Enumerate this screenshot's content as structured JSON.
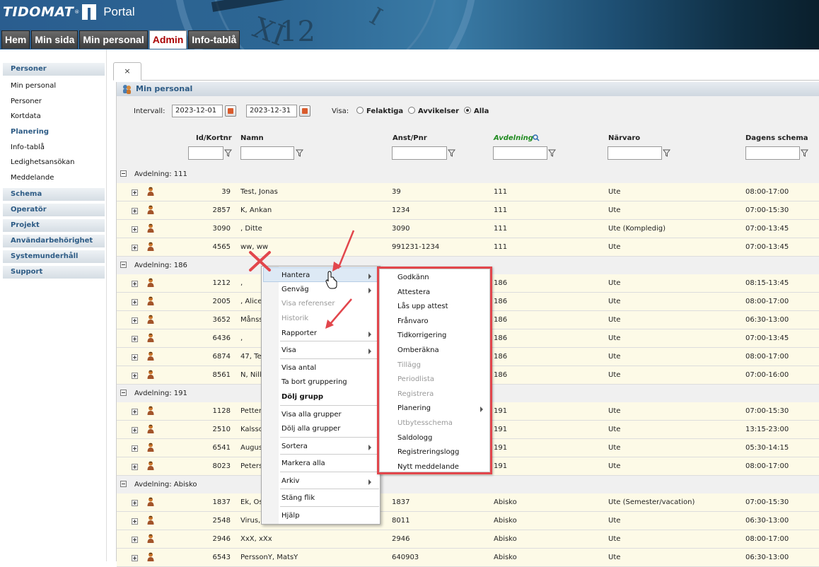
{
  "header": {
    "brand": "TIDOMAT",
    "trademark": "®",
    "portal": "Portal",
    "nav": [
      "Hem",
      "Min sida",
      "Min personal",
      "Admin",
      "Info-tablå"
    ],
    "active_nav": "Admin"
  },
  "sidebar": {
    "personer_heading": "Personer",
    "personer_items": [
      "Min personal",
      "Personer",
      "Kortdata"
    ],
    "planering_heading": "Planering",
    "planering_items": [
      "Info-tablå",
      "Ledighetsansökan",
      "Meddelande"
    ],
    "sections": [
      "Schema",
      "Operatör",
      "Projekt",
      "Användarbehörighet",
      "Systemunderhåll",
      "Support"
    ]
  },
  "tab": {
    "close": "×"
  },
  "panel": {
    "title": "Min personal",
    "intervall_label": "Intervall:",
    "date_from": "2023-12-01",
    "date_to": "2023-12-31",
    "visa_label": "Visa:",
    "radio_options": [
      "Felaktiga",
      "Avvikelser",
      "Alla"
    ],
    "radio_selected": "Alla"
  },
  "columns": {
    "id": "Id/Kortnr",
    "name": "Namn",
    "anst": "Anst/Pnr",
    "avd": "Avdelning",
    "narvaro": "Närvaro",
    "schema": "Dagens schema",
    "avd_color": "#1f8a1f"
  },
  "groups": [
    {
      "label": "Avdelning: 111",
      "rows": [
        {
          "id": "39",
          "name": "Test, Jonas",
          "anst": "39",
          "avd": "111",
          "narvaro": "Ute",
          "schema": "08:00-17:00"
        },
        {
          "id": "2857",
          "name": "K, Ankan",
          "anst": "1234",
          "avd": "111",
          "narvaro": "Ute",
          "schema": "07:00-15:30"
        },
        {
          "id": "3090",
          "name": ", Ditte",
          "anst": "3090",
          "avd": "111",
          "narvaro": "Ute (Kompledig)",
          "schema": "07:00-13:45"
        },
        {
          "id": "4565",
          "name": "ww, ww",
          "anst": "991231-1234",
          "avd": "111",
          "narvaro": "Ute",
          "schema": "07:00-13:45"
        }
      ]
    },
    {
      "label": "Avdelning: 186",
      "rows": [
        {
          "id": "1212",
          "name": ",",
          "anst": "",
          "avd": "186",
          "narvaro": "Ute",
          "schema": "08:15-13:45"
        },
        {
          "id": "2005",
          "name": ", Alice",
          "anst": "",
          "avd": "186",
          "narvaro": "Ute",
          "schema": "08:00-17:00"
        },
        {
          "id": "3652",
          "name": "Månss",
          "anst": "",
          "avd": "186",
          "narvaro": "Ute",
          "schema": "06:30-13:00"
        },
        {
          "id": "6436",
          "name": ",",
          "anst": "",
          "avd": "186",
          "narvaro": "Ute",
          "schema": "07:00-13:45"
        },
        {
          "id": "6874",
          "name": "47, Te",
          "anst": "",
          "avd": "186",
          "narvaro": "Ute",
          "schema": "08:00-17:00"
        },
        {
          "id": "8561",
          "name": "N, Nill",
          "anst": "",
          "avd": "186",
          "narvaro": "Ute",
          "schema": "07:00-16:00"
        }
      ]
    },
    {
      "label": "Avdelning: 191",
      "rows": [
        {
          "id": "1128",
          "name": "Petter",
          "anst": "",
          "avd": "191",
          "narvaro": "Ute",
          "schema": "07:00-15:30"
        },
        {
          "id": "2510",
          "name": "Kalsso",
          "anst": "",
          "avd": "191",
          "narvaro": "Ute",
          "schema": "13:15-23:00"
        },
        {
          "id": "6541",
          "name": "Augus",
          "anst": "",
          "avd": "191",
          "narvaro": "Ute",
          "schema": "05:30-14:15"
        },
        {
          "id": "8023",
          "name": "Peters",
          "anst": "",
          "avd": "191",
          "narvaro": "Ute",
          "schema": "08:00-17:00"
        }
      ]
    },
    {
      "label": "Avdelning: Abisko",
      "rows": [
        {
          "id": "1837",
          "name": "Ek, Os",
          "anst": "1837",
          "avd": "Abisko",
          "narvaro": "Ute (Semester/vacation)",
          "schema": "07:00-15:30"
        },
        {
          "id": "2548",
          "name": "Virus,",
          "anst": "8011",
          "avd": "Abisko",
          "narvaro": "Ute",
          "schema": "06:30-13:00"
        },
        {
          "id": "2946",
          "name": "XxX, xXx",
          "anst": "2946",
          "avd": "Abisko",
          "narvaro": "Ute",
          "schema": "08:00-17:00"
        },
        {
          "id": "6543",
          "name": "PerssonY, MatsY",
          "anst": "640903",
          "avd": "Abisko",
          "narvaro": "Ute",
          "schema": "06:30-13:00"
        }
      ]
    }
  ],
  "context_menu": [
    {
      "label": "Hantera",
      "submenu": true,
      "highlighted": true
    },
    {
      "label": "Genväg",
      "submenu": true
    },
    {
      "label": "Visa referenser",
      "disabled": true
    },
    {
      "label": "Historik",
      "disabled": true
    },
    {
      "label": "Rapporter",
      "submenu": true
    },
    {
      "label": "Visa",
      "submenu": true
    },
    {
      "label": "Visa antal"
    },
    {
      "label": "Ta bort gruppering"
    },
    {
      "label": "Dölj grupp",
      "bold": true
    },
    {
      "label": "Visa alla grupper"
    },
    {
      "label": "Dölj alla grupper"
    },
    {
      "label": "Sortera",
      "submenu": true
    },
    {
      "label": "Markera alla"
    },
    {
      "label": "Arkiv",
      "submenu": true
    },
    {
      "label": "Stäng flik"
    },
    {
      "label": "Hjälp"
    }
  ],
  "submenu": [
    {
      "label": "Godkänn"
    },
    {
      "label": "Attestera"
    },
    {
      "label": "Lås upp attest"
    },
    {
      "label": "Frånvaro"
    },
    {
      "label": "Tidkorrigering"
    },
    {
      "label": "Omberäkna"
    },
    {
      "label": "Tillägg",
      "disabled": true
    },
    {
      "label": "Periodlista",
      "disabled": true
    },
    {
      "label": "Registrera",
      "disabled": true
    },
    {
      "label": "Planering",
      "submenu": true
    },
    {
      "label": "Utbytesschema",
      "disabled": true
    },
    {
      "label": "Saldologg"
    },
    {
      "label": "Registreringslogg"
    },
    {
      "label": "Nytt meddelande"
    }
  ],
  "colors": {
    "annotation_red": "#e2464c",
    "row_bg": "#fdfae7",
    "accent_blue": "#2d5b85"
  },
  "icons": {
    "tab_close": "close-icon",
    "panel_title": "people-icon",
    "calendar": "calendar-icon",
    "filter": "filter-icon",
    "group_toggle": "collapse-icon",
    "row_toggle": "expand-icon",
    "person": "person-icon",
    "search": "search-icon",
    "submenu": "chevron-right-icon",
    "pointer": "hand-cursor-icon",
    "close_x": "close-x-icon"
  }
}
